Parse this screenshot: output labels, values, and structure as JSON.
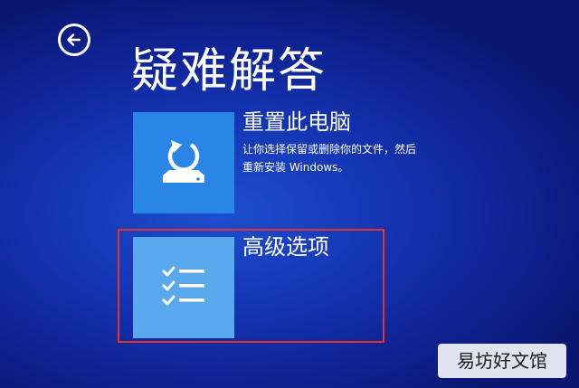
{
  "header": {
    "title": "疑难解答",
    "back_icon": "back-arrow-icon"
  },
  "options": [
    {
      "title": "重置此电脑",
      "description_line1": "让你选择保留或删除你的文件，然后",
      "description_line2": "重新安装 Windows。",
      "icon": "reset-pc-icon"
    },
    {
      "title": "高级选项",
      "icon": "checklist-icon"
    }
  ],
  "watermark": {
    "text": "易坊好文馆"
  },
  "colors": {
    "background": "#1432b0",
    "reset_tile": "#2a86e6",
    "advanced_tile": "#5aa9ef",
    "highlight_box": "#e2342c",
    "text": "#ffffff"
  }
}
